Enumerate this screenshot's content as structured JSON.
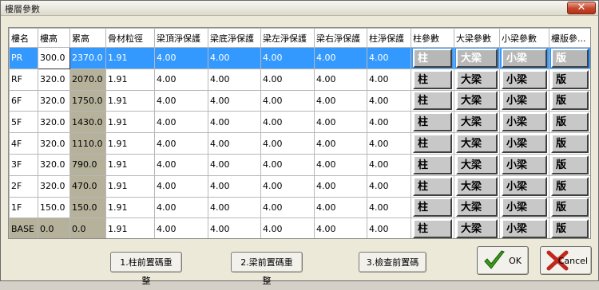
{
  "window": {
    "title": "樓層參數",
    "close_glyph": "✕"
  },
  "grid": {
    "headers": [
      "樓名",
      "樓高",
      "累高",
      "骨材粒徑",
      "梁頂淨保護",
      "梁底淨保護",
      "梁左淨保護",
      "梁右淨保護",
      "柱淨保護",
      "柱參數",
      "大梁參數",
      "小梁參數",
      "樓版參..."
    ],
    "rows": [
      {
        "name": "PR",
        "height": "300.0",
        "cum": "2370.0",
        "agg": "1.91",
        "top": "4.00",
        "bot": "4.00",
        "left": "4.00",
        "right": "4.00",
        "col": "4.00",
        "b1": "柱",
        "b2": "大梁",
        "b3": "小梁",
        "b4": "版"
      },
      {
        "name": "RF",
        "height": "320.0",
        "cum": "2070.0",
        "agg": "1.91",
        "top": "4.00",
        "bot": "4.00",
        "left": "4.00",
        "right": "4.00",
        "col": "4.00",
        "b1": "柱",
        "b2": "大梁",
        "b3": "小梁",
        "b4": "版"
      },
      {
        "name": "6F",
        "height": "320.0",
        "cum": "1750.0",
        "agg": "1.91",
        "top": "4.00",
        "bot": "4.00",
        "left": "4.00",
        "right": "4.00",
        "col": "4.00",
        "b1": "柱",
        "b2": "大梁",
        "b3": "小梁",
        "b4": "版"
      },
      {
        "name": "5F",
        "height": "320.0",
        "cum": "1430.0",
        "agg": "1.91",
        "top": "4.00",
        "bot": "4.00",
        "left": "4.00",
        "right": "4.00",
        "col": "4.00",
        "b1": "柱",
        "b2": "大梁",
        "b3": "小梁",
        "b4": "版"
      },
      {
        "name": "4F",
        "height": "320.0",
        "cum": "1110.0",
        "agg": "1.91",
        "top": "4.00",
        "bot": "4.00",
        "left": "4.00",
        "right": "4.00",
        "col": "4.00",
        "b1": "柱",
        "b2": "大梁",
        "b3": "小梁",
        "b4": "版"
      },
      {
        "name": "3F",
        "height": "320.0",
        "cum": "790.0",
        "agg": "1.91",
        "top": "4.00",
        "bot": "4.00",
        "left": "4.00",
        "right": "4.00",
        "col": "4.00",
        "b1": "柱",
        "b2": "大梁",
        "b3": "小梁",
        "b4": "版"
      },
      {
        "name": "2F",
        "height": "320.0",
        "cum": "470.0",
        "agg": "1.91",
        "top": "4.00",
        "bot": "4.00",
        "left": "4.00",
        "right": "4.00",
        "col": "4.00",
        "b1": "柱",
        "b2": "大梁",
        "b3": "小梁",
        "b4": "版"
      },
      {
        "name": "1F",
        "height": "150.0",
        "cum": "150.0",
        "agg": "1.91",
        "top": "4.00",
        "bot": "4.00",
        "left": "4.00",
        "right": "4.00",
        "col": "4.00",
        "b1": "柱",
        "b2": "大梁",
        "b3": "小梁",
        "b4": "版"
      },
      {
        "name": "BASE",
        "height": "0.0",
        "cum": "0.0",
        "agg": "1.91",
        "top": "4.00",
        "bot": "4.00",
        "left": "4.00",
        "right": "4.00",
        "col": "4.00",
        "b1": "柱",
        "b2": "大梁",
        "b3": "小梁",
        "b4": "版"
      }
    ]
  },
  "footer": {
    "reset_column_label": "1.柱前置碼重整",
    "reset_beam_label": "2.梁前置碼重整",
    "check_label": "3.檢查前置碼",
    "ok_label": "OK",
    "cancel_label": "Cancel"
  },
  "colors": {
    "selected_row": "#3399ff",
    "tan_cell": "#b5b19a",
    "ok_check": "#3a9a1a",
    "cancel_x": "#c0281e"
  },
  "icons": {
    "ok": "green-checkmark-icon",
    "cancel": "red-x-icon"
  }
}
